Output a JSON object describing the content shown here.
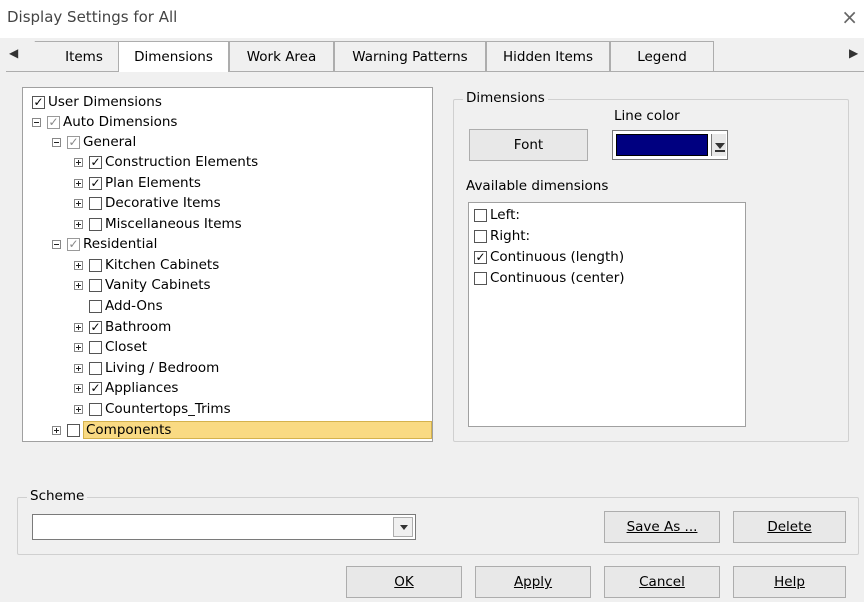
{
  "window": {
    "title": "Display Settings for All",
    "close_glyph": "×"
  },
  "tab_nav": {
    "left_arrow": "◀",
    "right_arrow": "▶"
  },
  "tabs": [
    "Items",
    "Dimensions",
    "Work Area",
    "Warning Patterns",
    "Hidden Items",
    "Legend"
  ],
  "active_tab": "Dimensions",
  "tree": [
    {
      "label": "User Dimensions",
      "checked": true
    },
    {
      "label": "Auto Dimensions",
      "checked": "indeterminate",
      "expander": "minus"
    },
    {
      "label": "General",
      "checked": "indeterminate",
      "expander": "minus"
    },
    {
      "label": "Construction Elements",
      "checked": true,
      "expander": "plus"
    },
    {
      "label": "Plan Elements",
      "checked": true,
      "expander": "plus"
    },
    {
      "label": "Decorative Items",
      "checked": false,
      "expander": "plus"
    },
    {
      "label": "Miscellaneous Items",
      "checked": false,
      "expander": "plus"
    },
    {
      "label": "Residential",
      "checked": "indeterminate",
      "expander": "minus"
    },
    {
      "label": "Kitchen Cabinets",
      "checked": false,
      "expander": "plus"
    },
    {
      "label": "Vanity Cabinets",
      "checked": false,
      "expander": "plus"
    },
    {
      "label": "Add-Ons",
      "checked": false
    },
    {
      "label": "Bathroom",
      "checked": true,
      "expander": "plus"
    },
    {
      "label": "Closet",
      "checked": false,
      "expander": "plus"
    },
    {
      "label": "Living / Bedroom",
      "checked": false,
      "expander": "plus"
    },
    {
      "label": "Appliances",
      "checked": true,
      "expander": "plus"
    },
    {
      "label": "Countertops_Trims",
      "checked": false,
      "expander": "plus"
    },
    {
      "label": "Components",
      "checked": false,
      "expander": "plus",
      "selected": true
    }
  ],
  "dimensions_group": {
    "label": "Dimensions",
    "font_button": "Font",
    "line_color_label": "Line color",
    "line_color": "#000080",
    "available_label": "Available dimensions",
    "available": [
      {
        "label": "Left:",
        "checked": false
      },
      {
        "label": "Right:",
        "checked": false
      },
      {
        "label": "Continuous (length)",
        "checked": true
      },
      {
        "label": "Continuous (center)",
        "checked": false
      }
    ]
  },
  "scheme": {
    "label": "Scheme",
    "value": "",
    "save_as_button": "Save As ...",
    "delete_button": "Delete"
  },
  "footer": {
    "ok": "OK",
    "apply": "Apply",
    "cancel": "Cancel",
    "help": "Help"
  }
}
